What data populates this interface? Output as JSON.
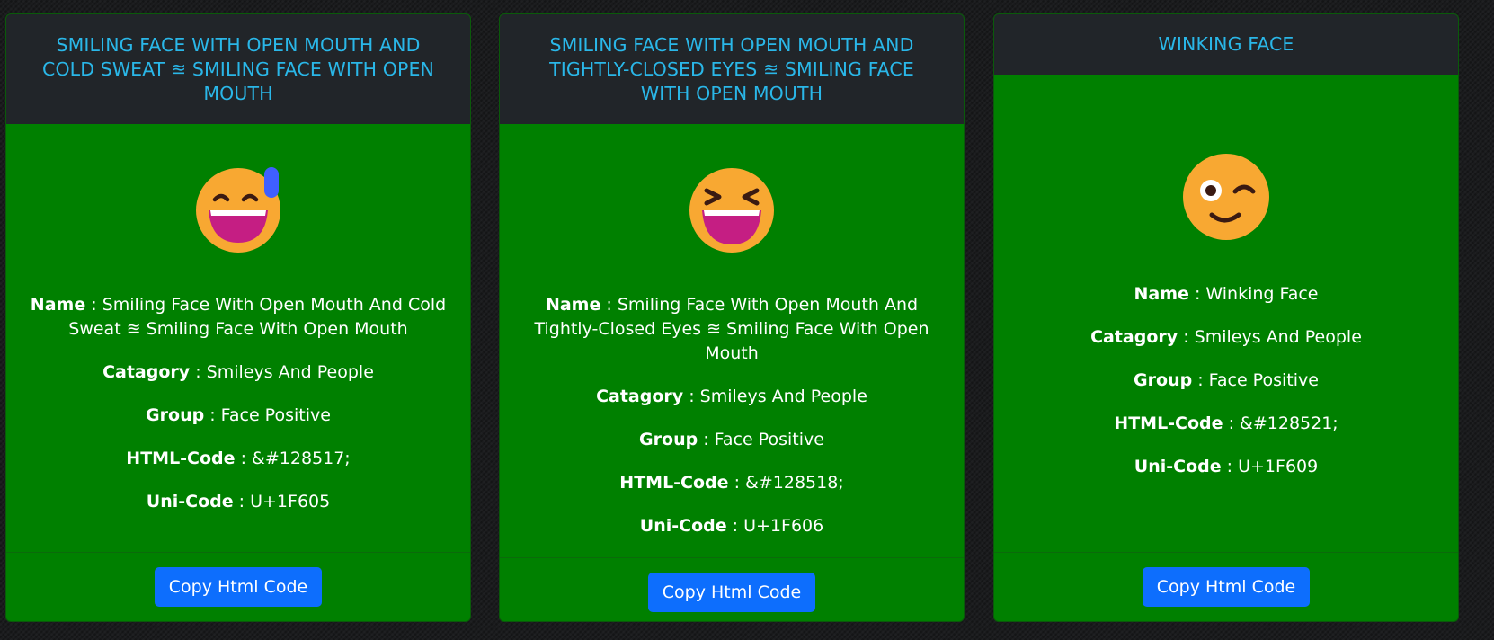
{
  "cards": [
    {
      "title": "SMILING FACE WITH OPEN MOUTH AND COLD SWEAT ≊ SMILING FACE WITH OPEN MOUTH",
      "emoji_icon": "grinning-face-with-sweat-icon",
      "name_label": "Name",
      "name_value": " : Smiling Face With Open Mouth And Cold Sweat ≊ Smiling Face With Open Mouth",
      "category_label": "Catagory",
      "category_value": " : Smileys And People",
      "group_label": "Group",
      "group_value": " : Face Positive",
      "html_code_label": "HTML-Code",
      "html_code_value": " : &#128517;",
      "unicode_label": "Uni-Code",
      "unicode_value": " : U+1F605",
      "button_label": "Copy Html Code"
    },
    {
      "title": "SMILING FACE WITH OPEN MOUTH AND TIGHTLY-CLOSED EYES ≊ SMILING FACE WITH OPEN MOUTH",
      "emoji_icon": "grinning-squinting-face-icon",
      "name_label": "Name",
      "name_value": " : Smiling Face With Open Mouth And Tightly-Closed Eyes ≊ Smiling Face With Open Mouth",
      "category_label": "Catagory",
      "category_value": " : Smileys And People",
      "group_label": "Group",
      "group_value": " : Face Positive",
      "html_code_label": "HTML-Code",
      "html_code_value": " : &#128518;",
      "unicode_label": "Uni-Code",
      "unicode_value": " : U+1F606",
      "button_label": "Copy Html Code"
    },
    {
      "title": "WINKING FACE",
      "emoji_icon": "winking-face-icon",
      "name_label": "Name",
      "name_value": " : Winking Face",
      "category_label": "Catagory",
      "category_value": " : Smileys And People",
      "group_label": "Group",
      "group_value": " : Face Positive",
      "html_code_label": "HTML-Code",
      "html_code_value": " : &#128521;",
      "unicode_label": "Uni-Code",
      "unicode_value": " : U+1F609",
      "button_label": "Copy Html Code"
    }
  ],
  "colors": {
    "card_background": "#008000",
    "header_background": "#212529",
    "header_text": "#2ab7e8",
    "button_background": "#0d6efd",
    "emoji_face": "#f8a832",
    "emoji_mouth": "#c51e83",
    "sweat_drop": "#3f5fff"
  }
}
